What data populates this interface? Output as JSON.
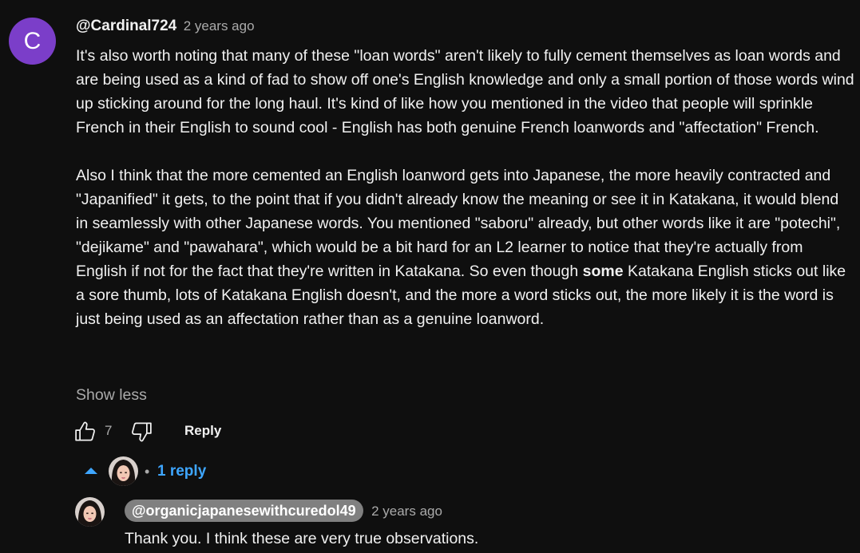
{
  "comment": {
    "avatar_letter": "C",
    "avatar_color": "#7b3ec9",
    "author": "@Cardinal724",
    "time": "2 years ago",
    "paragraph_1": "It's also worth noting that many of these \"loan words\" aren't likely to fully cement themselves as loan words and are being used as a kind of fad to show off one's English knowledge and only a small portion of those words wind up sticking around for the long haul. It's kind of like how you mentioned in the video that people will sprinkle French in their English to sound cool - English has both genuine French loanwords and \"affectation\" French.",
    "paragraph_2_before_bold": "Also I think that the more cemented an English loanword gets into Japanese, the more heavily contracted and \"Japanified\" it gets, to the point that if you didn't already know the meaning or see it in Katakana, it would blend in seamlessly with other Japanese words. You mentioned \"saboru\" already, but other words like it  are \"potechi\", \"dejikame\" and \"pawahara\", which would be a bit hard for an L2 learner to notice  that they're actually from English if not for the fact that they're written in Katakana. So even though ",
    "paragraph_2_bold": "some",
    "paragraph_2_after_bold": " Katakana English sticks out like a sore thumb, lots of Katakana English doesn't, and the more a word sticks out, the more likely it is the word is just being used as an affectation rather than as a genuine loanword.",
    "show_less_label": "Show less",
    "like_count": "7",
    "reply_label": "Reply"
  },
  "replies_toggle": {
    "dot": "•",
    "label": "1 reply",
    "accent_color": "#3ea6ff"
  },
  "reply": {
    "author": "@organicjapanesewithcuredol49",
    "time": "2 years ago",
    "text": "Thank you. I think these are very true observations."
  },
  "icons": {
    "like": "thumb-up-icon",
    "dislike": "thumb-down-icon",
    "collapse": "caret-up-icon"
  }
}
